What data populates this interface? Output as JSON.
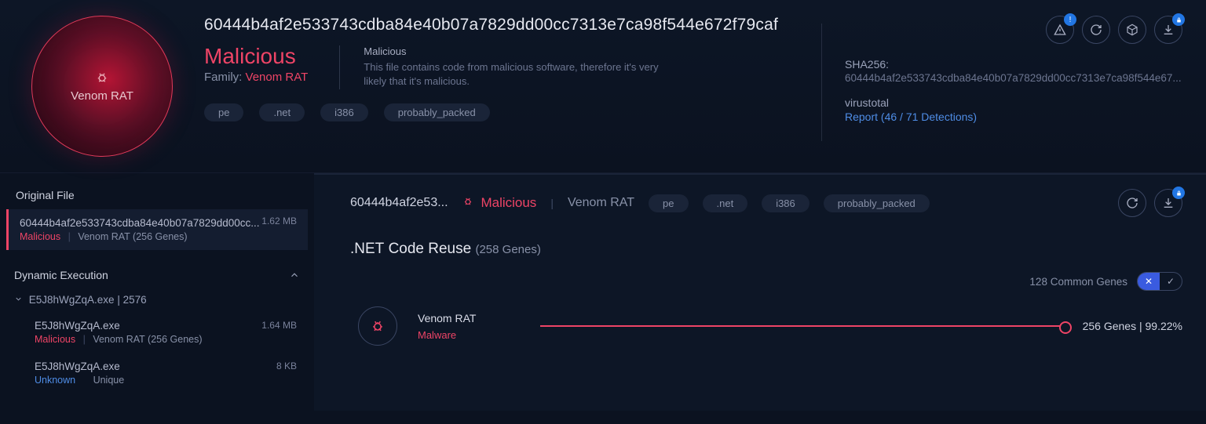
{
  "header": {
    "threat_name": "Venom RAT",
    "hash_title": "60444b4af2e533743cdba84e40b07a7829dd00cc7313e7ca98f544e672f79caf",
    "verdict": "Malicious",
    "family_label": "Family:",
    "family_value": "Venom RAT",
    "explain_title": "Malicious",
    "explain_text": "This file contains code from malicious software, therefore it's very likely that it's malicious.",
    "tags": [
      "pe",
      ".net",
      "i386",
      "probably_packed"
    ]
  },
  "meta": {
    "hash_label": "SHA256:",
    "hash_value": "60444b4af2e533743cdba84e40b07a7829dd00cc7313e7ca98f544e67...",
    "vt_label": "virustotal",
    "vt_link": "Report (46 / 71 Detections)"
  },
  "sidebar": {
    "original_title": "Original File",
    "original": {
      "size": "1.62 MB",
      "name": "60444b4af2e533743cdba84e40b07a7829dd00cc...",
      "verdict": "Malicious",
      "family": "Venom RAT (256 Genes)"
    },
    "dyn_title": "Dynamic Execution",
    "tree_root": "E5J8hWgZqA.exe | 2576",
    "children": [
      {
        "name": "E5J8hWgZqA.exe",
        "size": "1.64 MB",
        "verdict": "Malicious",
        "verdict_class": "mal",
        "family": "Venom RAT (256 Genes)"
      },
      {
        "name": "E5J8hWgZqA.exe",
        "size": "8 KB",
        "verdict": "Unknown",
        "verdict_class": "unk",
        "family": "Unique"
      }
    ]
  },
  "content": {
    "crumb_hash": "60444b4af2e53...",
    "crumb_verdict": "Malicious",
    "crumb_family": "Venom RAT",
    "tags": [
      "pe",
      ".net",
      "i386",
      "probably_packed"
    ],
    "section_prefix": ".NET",
    "section_title": "Code Reuse",
    "section_sub": "(258 Genes)",
    "filter_label": "128 Common Genes",
    "gene": {
      "name": "Venom RAT",
      "type": "Malware",
      "count": "256 Genes | 99.22%"
    }
  }
}
